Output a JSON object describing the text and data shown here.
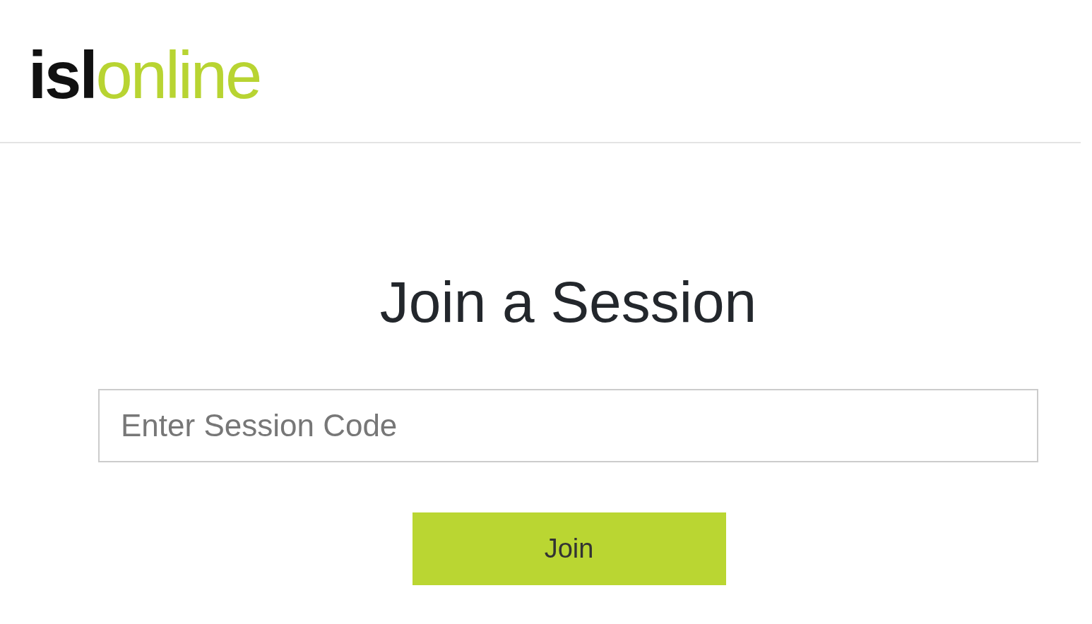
{
  "header": {
    "logo": [
      {
        "text": "isl",
        "kind": "dark"
      },
      {
        "text": "online",
        "kind": "accent"
      }
    ]
  },
  "title": "Join a Session",
  "session_code_field": {
    "placeholder": "Enter Session Code"
  },
  "join_button": {
    "label": "Join"
  }
}
